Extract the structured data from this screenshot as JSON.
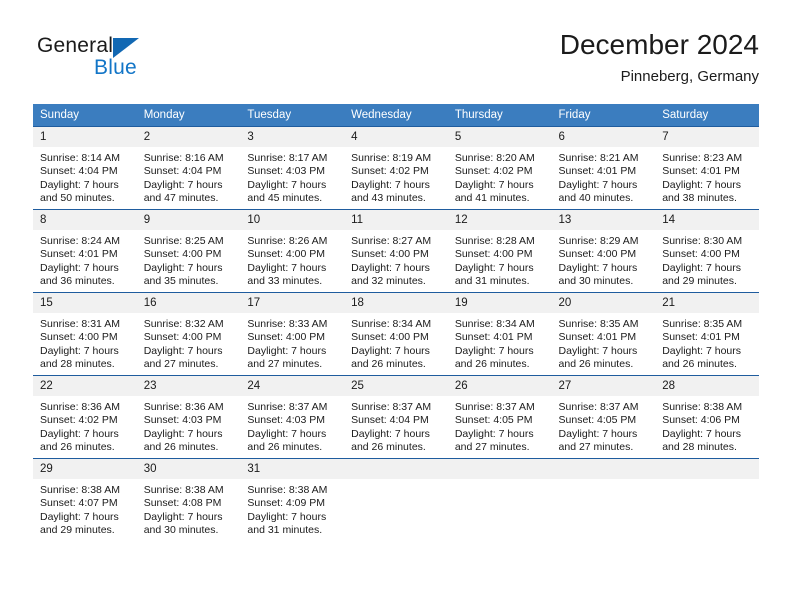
{
  "logo": {
    "word_general": "General",
    "word_blue": "Blue",
    "triangle_color": "#1268b3",
    "blue_color": "#1275c7"
  },
  "header": {
    "title": "December 2024",
    "subtitle": "Pinneberg, Germany"
  },
  "theme": {
    "header_bg": "#3b7dbf",
    "header_text": "#ffffff",
    "row_divider": "#1f5c9e",
    "daynum_bg": "#f1f1f1"
  },
  "weekdays": [
    "Sunday",
    "Monday",
    "Tuesday",
    "Wednesday",
    "Thursday",
    "Friday",
    "Saturday"
  ],
  "labels": {
    "sunrise_prefix": "Sunrise:",
    "sunset_prefix": "Sunset:",
    "daylight_prefix": "Daylight:"
  },
  "weeks": [
    [
      {
        "day": "1",
        "sunrise": "Sunrise: 8:14 AM",
        "sunset": "Sunset: 4:04 PM",
        "daylight1": "Daylight: 7 hours",
        "daylight2": "and 50 minutes."
      },
      {
        "day": "2",
        "sunrise": "Sunrise: 8:16 AM",
        "sunset": "Sunset: 4:04 PM",
        "daylight1": "Daylight: 7 hours",
        "daylight2": "and 47 minutes."
      },
      {
        "day": "3",
        "sunrise": "Sunrise: 8:17 AM",
        "sunset": "Sunset: 4:03 PM",
        "daylight1": "Daylight: 7 hours",
        "daylight2": "and 45 minutes."
      },
      {
        "day": "4",
        "sunrise": "Sunrise: 8:19 AM",
        "sunset": "Sunset: 4:02 PM",
        "daylight1": "Daylight: 7 hours",
        "daylight2": "and 43 minutes."
      },
      {
        "day": "5",
        "sunrise": "Sunrise: 8:20 AM",
        "sunset": "Sunset: 4:02 PM",
        "daylight1": "Daylight: 7 hours",
        "daylight2": "and 41 minutes."
      },
      {
        "day": "6",
        "sunrise": "Sunrise: 8:21 AM",
        "sunset": "Sunset: 4:01 PM",
        "daylight1": "Daylight: 7 hours",
        "daylight2": "and 40 minutes."
      },
      {
        "day": "7",
        "sunrise": "Sunrise: 8:23 AM",
        "sunset": "Sunset: 4:01 PM",
        "daylight1": "Daylight: 7 hours",
        "daylight2": "and 38 minutes."
      }
    ],
    [
      {
        "day": "8",
        "sunrise": "Sunrise: 8:24 AM",
        "sunset": "Sunset: 4:01 PM",
        "daylight1": "Daylight: 7 hours",
        "daylight2": "and 36 minutes."
      },
      {
        "day": "9",
        "sunrise": "Sunrise: 8:25 AM",
        "sunset": "Sunset: 4:00 PM",
        "daylight1": "Daylight: 7 hours",
        "daylight2": "and 35 minutes."
      },
      {
        "day": "10",
        "sunrise": "Sunrise: 8:26 AM",
        "sunset": "Sunset: 4:00 PM",
        "daylight1": "Daylight: 7 hours",
        "daylight2": "and 33 minutes."
      },
      {
        "day": "11",
        "sunrise": "Sunrise: 8:27 AM",
        "sunset": "Sunset: 4:00 PM",
        "daylight1": "Daylight: 7 hours",
        "daylight2": "and 32 minutes."
      },
      {
        "day": "12",
        "sunrise": "Sunrise: 8:28 AM",
        "sunset": "Sunset: 4:00 PM",
        "daylight1": "Daylight: 7 hours",
        "daylight2": "and 31 minutes."
      },
      {
        "day": "13",
        "sunrise": "Sunrise: 8:29 AM",
        "sunset": "Sunset: 4:00 PM",
        "daylight1": "Daylight: 7 hours",
        "daylight2": "and 30 minutes."
      },
      {
        "day": "14",
        "sunrise": "Sunrise: 8:30 AM",
        "sunset": "Sunset: 4:00 PM",
        "daylight1": "Daylight: 7 hours",
        "daylight2": "and 29 minutes."
      }
    ],
    [
      {
        "day": "15",
        "sunrise": "Sunrise: 8:31 AM",
        "sunset": "Sunset: 4:00 PM",
        "daylight1": "Daylight: 7 hours",
        "daylight2": "and 28 minutes."
      },
      {
        "day": "16",
        "sunrise": "Sunrise: 8:32 AM",
        "sunset": "Sunset: 4:00 PM",
        "daylight1": "Daylight: 7 hours",
        "daylight2": "and 27 minutes."
      },
      {
        "day": "17",
        "sunrise": "Sunrise: 8:33 AM",
        "sunset": "Sunset: 4:00 PM",
        "daylight1": "Daylight: 7 hours",
        "daylight2": "and 27 minutes."
      },
      {
        "day": "18",
        "sunrise": "Sunrise: 8:34 AM",
        "sunset": "Sunset: 4:00 PM",
        "daylight1": "Daylight: 7 hours",
        "daylight2": "and 26 minutes."
      },
      {
        "day": "19",
        "sunrise": "Sunrise: 8:34 AM",
        "sunset": "Sunset: 4:01 PM",
        "daylight1": "Daylight: 7 hours",
        "daylight2": "and 26 minutes."
      },
      {
        "day": "20",
        "sunrise": "Sunrise: 8:35 AM",
        "sunset": "Sunset: 4:01 PM",
        "daylight1": "Daylight: 7 hours",
        "daylight2": "and 26 minutes."
      },
      {
        "day": "21",
        "sunrise": "Sunrise: 8:35 AM",
        "sunset": "Sunset: 4:01 PM",
        "daylight1": "Daylight: 7 hours",
        "daylight2": "and 26 minutes."
      }
    ],
    [
      {
        "day": "22",
        "sunrise": "Sunrise: 8:36 AM",
        "sunset": "Sunset: 4:02 PM",
        "daylight1": "Daylight: 7 hours",
        "daylight2": "and 26 minutes."
      },
      {
        "day": "23",
        "sunrise": "Sunrise: 8:36 AM",
        "sunset": "Sunset: 4:03 PM",
        "daylight1": "Daylight: 7 hours",
        "daylight2": "and 26 minutes."
      },
      {
        "day": "24",
        "sunrise": "Sunrise: 8:37 AM",
        "sunset": "Sunset: 4:03 PM",
        "daylight1": "Daylight: 7 hours",
        "daylight2": "and 26 minutes."
      },
      {
        "day": "25",
        "sunrise": "Sunrise: 8:37 AM",
        "sunset": "Sunset: 4:04 PM",
        "daylight1": "Daylight: 7 hours",
        "daylight2": "and 26 minutes."
      },
      {
        "day": "26",
        "sunrise": "Sunrise: 8:37 AM",
        "sunset": "Sunset: 4:05 PM",
        "daylight1": "Daylight: 7 hours",
        "daylight2": "and 27 minutes."
      },
      {
        "day": "27",
        "sunrise": "Sunrise: 8:37 AM",
        "sunset": "Sunset: 4:05 PM",
        "daylight1": "Daylight: 7 hours",
        "daylight2": "and 27 minutes."
      },
      {
        "day": "28",
        "sunrise": "Sunrise: 8:38 AM",
        "sunset": "Sunset: 4:06 PM",
        "daylight1": "Daylight: 7 hours",
        "daylight2": "and 28 minutes."
      }
    ],
    [
      {
        "day": "29",
        "sunrise": "Sunrise: 8:38 AM",
        "sunset": "Sunset: 4:07 PM",
        "daylight1": "Daylight: 7 hours",
        "daylight2": "and 29 minutes."
      },
      {
        "day": "30",
        "sunrise": "Sunrise: 8:38 AM",
        "sunset": "Sunset: 4:08 PM",
        "daylight1": "Daylight: 7 hours",
        "daylight2": "and 30 minutes."
      },
      {
        "day": "31",
        "sunrise": "Sunrise: 8:38 AM",
        "sunset": "Sunset: 4:09 PM",
        "daylight1": "Daylight: 7 hours",
        "daylight2": "and 31 minutes."
      },
      {
        "day": "",
        "sunrise": "",
        "sunset": "",
        "daylight1": "",
        "daylight2": ""
      },
      {
        "day": "",
        "sunrise": "",
        "sunset": "",
        "daylight1": "",
        "daylight2": ""
      },
      {
        "day": "",
        "sunrise": "",
        "sunset": "",
        "daylight1": "",
        "daylight2": ""
      },
      {
        "day": "",
        "sunrise": "",
        "sunset": "",
        "daylight1": "",
        "daylight2": ""
      }
    ]
  ]
}
